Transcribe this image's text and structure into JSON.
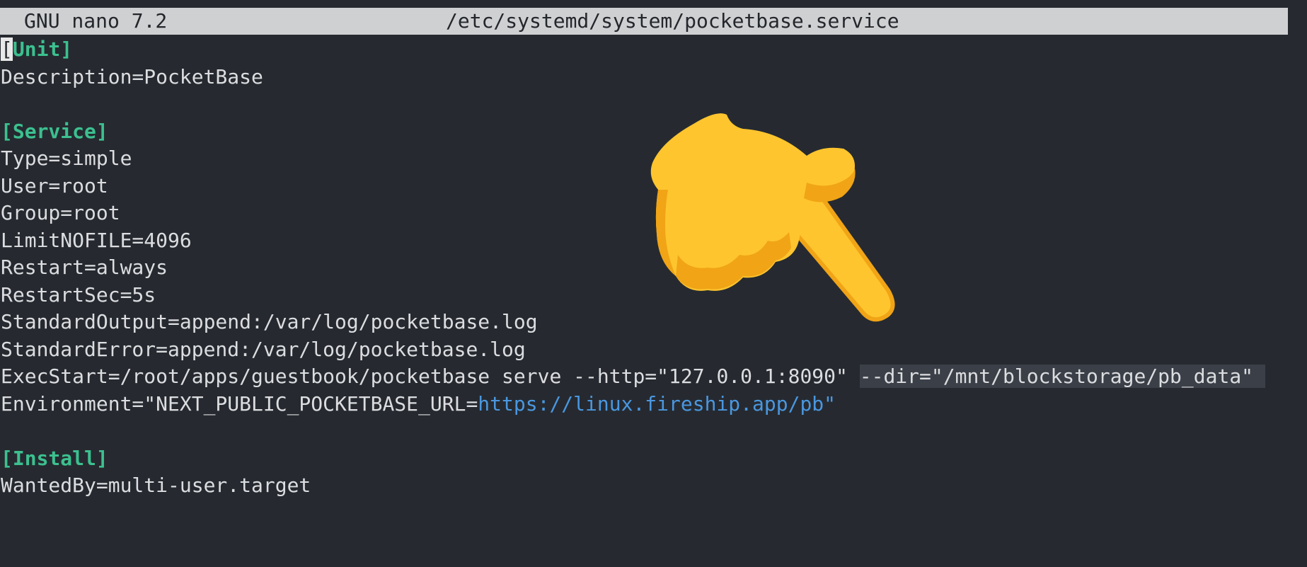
{
  "titlebar": {
    "app_version": "GNU nano 7.2",
    "file_path": "/etc/systemd/system/pocketbase.service"
  },
  "editor": {
    "lines": [
      {
        "type": "section",
        "open": "[",
        "name": "Unit",
        "close": "]"
      },
      {
        "type": "text",
        "text": "Description=PocketBase"
      },
      {
        "type": "blank"
      },
      {
        "type": "section",
        "open": "[",
        "name": "Service",
        "close": "]"
      },
      {
        "type": "text",
        "text": "Type=simple"
      },
      {
        "type": "text",
        "text": "User=root"
      },
      {
        "type": "text",
        "text": "Group=root"
      },
      {
        "type": "text",
        "text": "LimitNOFILE=4096"
      },
      {
        "type": "text",
        "text": "Restart=always"
      },
      {
        "type": "text",
        "text": "RestartSec=5s"
      },
      {
        "type": "text",
        "text": "StandardOutput=append:/var/log/pocketbase.log"
      },
      {
        "type": "text",
        "text": "StandardError=append:/var/log/pocketbase.log"
      },
      {
        "type": "exec",
        "text": "ExecStart=/root/apps/guestbook/pocketbase serve --http=\"127.0.0.1:8090\" ",
        "highlight": "--dir=\"/mnt/blockstorage/pb_data\" "
      },
      {
        "type": "env",
        "prefix": "Environment=\"NEXT_PUBLIC_POCKETBASE_URL=",
        "url": "https://linux.fireship.app/pb",
        "suffix": "\""
      },
      {
        "type": "blank"
      },
      {
        "type": "section",
        "open": "[",
        "name": "Install",
        "close": "]"
      },
      {
        "type": "text",
        "text": "WantedBy=multi-user.target"
      }
    ]
  },
  "overlay": {
    "icon": "pointing-down-hand-icon",
    "skin_color": "#ffc52e",
    "shade_color": "#f0a416"
  }
}
